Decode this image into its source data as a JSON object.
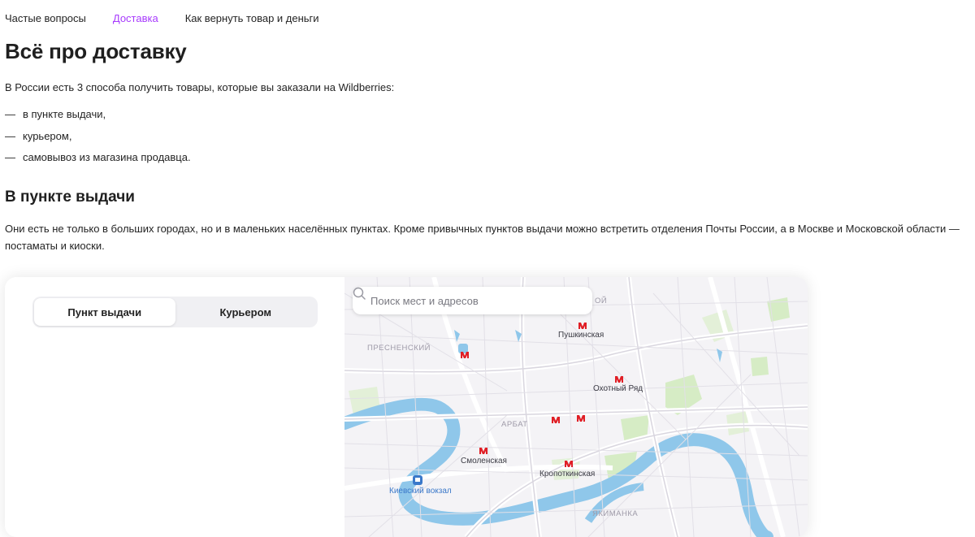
{
  "nav": {
    "items": [
      {
        "label": "Частые вопросы"
      },
      {
        "label": "Доставка"
      },
      {
        "label": "Как вернуть товар и деньги"
      }
    ]
  },
  "page": {
    "title": "Всё про доставку",
    "intro": "В России есть 3 способа получить товары, которые вы заказали на Wildberries:",
    "ways": [
      {
        "dash": "—",
        "text": "в пункте выдачи,"
      },
      {
        "dash": "—",
        "text": "курьером,"
      },
      {
        "dash": "—",
        "text": "самовывоз из магазина продавца."
      }
    ],
    "section_title": "В пункте выдачи",
    "section_text": "Они есть не только в больших городах, но и в маленьких населённых пунктах. Кроме привычных пунктов выдачи можно встретить отделения Почты России, а в Москве и Московской области — постаматы и киоски."
  },
  "widget": {
    "tabs": [
      {
        "label": "Пункт выдачи"
      },
      {
        "label": "Курьером"
      }
    ],
    "search_placeholder": "Поиск мест и адресов"
  },
  "map": {
    "districts": {
      "presnensky": "ПРЕСНЕНСКИЙ",
      "arbat": "АРБАТ",
      "yakimanka": "ЯКИМАНКА",
      "tverskoy_partial": "ОЙ"
    },
    "stations": {
      "pushkinskaya": "Пушкинская",
      "okhotny": "Охотный Ряд",
      "smolenskaya": "Смоленская",
      "kropotkinskaya": "Кропоткинская",
      "kievsky": "Киевский вокзал"
    }
  },
  "colors": {
    "accent": "#a73afd",
    "metro": "#e01f26",
    "river": "#8fc7ea",
    "park": "#d6ecc5"
  }
}
